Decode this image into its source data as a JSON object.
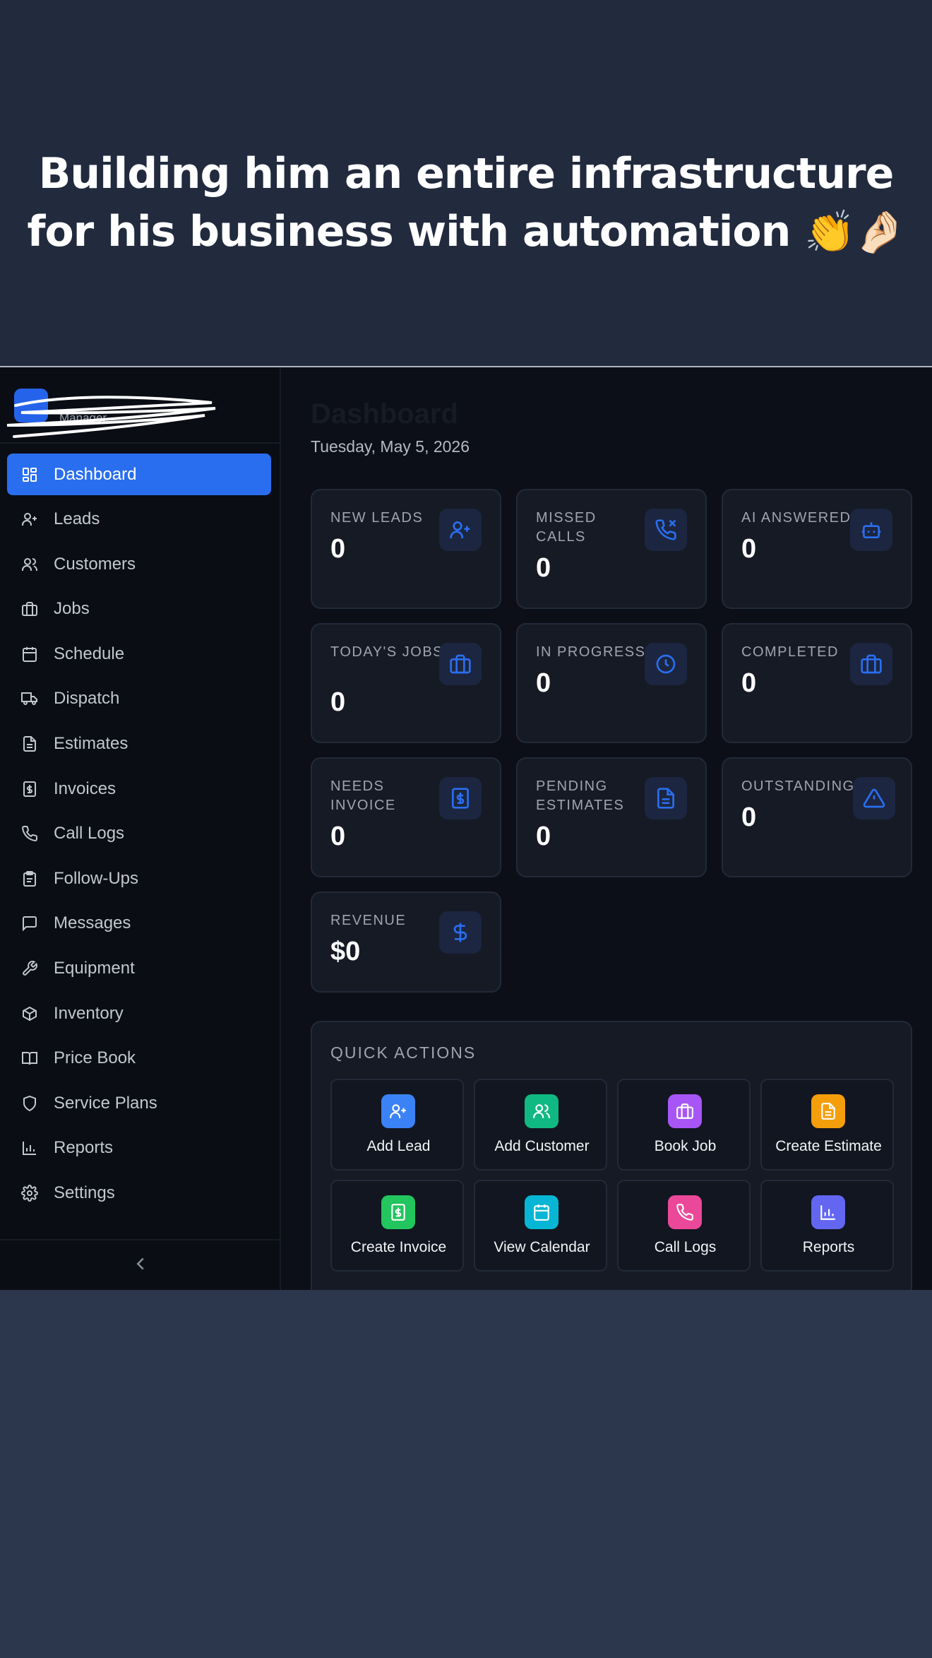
{
  "caption": {
    "text": "Building him an entire infrastructure for his business with automation",
    "emoji": "👏🤌🏻"
  },
  "colors": {
    "accent": "#2a6ef0",
    "app_background": "#0c0f17",
    "card_background": "#151a25",
    "caption_background": "#222a3e"
  },
  "brand": {
    "name": "",
    "subtitle": "Manager",
    "logo_icon": "logo-square"
  },
  "sidebar": {
    "items": [
      {
        "label": "Dashboard",
        "icon": "dashboard-icon",
        "active": true
      },
      {
        "label": "Leads",
        "icon": "user-plus-icon"
      },
      {
        "label": "Customers",
        "icon": "users-icon"
      },
      {
        "label": "Jobs",
        "icon": "briefcase-icon"
      },
      {
        "label": "Schedule",
        "icon": "calendar-icon"
      },
      {
        "label": "Dispatch",
        "icon": "truck-icon"
      },
      {
        "label": "Estimates",
        "icon": "document-icon"
      },
      {
        "label": "Invoices",
        "icon": "invoice-icon"
      },
      {
        "label": "Call Logs",
        "icon": "phone-icon"
      },
      {
        "label": "Follow-Ups",
        "icon": "clipboard-icon"
      },
      {
        "label": "Messages",
        "icon": "message-icon"
      },
      {
        "label": "Equipment",
        "icon": "wrench-icon"
      },
      {
        "label": "Inventory",
        "icon": "package-icon"
      },
      {
        "label": "Price Book",
        "icon": "book-icon"
      },
      {
        "label": "Service Plans",
        "icon": "shield-icon"
      },
      {
        "label": "Reports",
        "icon": "bar-chart-icon"
      },
      {
        "label": "Settings",
        "icon": "gear-icon"
      }
    ],
    "collapse_icon": "chevron-left-icon"
  },
  "header": {
    "title": "Dashboard",
    "date": "Tuesday, May 5, 2026"
  },
  "stats": [
    {
      "label": "NEW LEADS",
      "value": "0",
      "icon": "user-plus-icon"
    },
    {
      "label": "MISSED CALLS",
      "value": "0",
      "icon": "phone-missed-icon"
    },
    {
      "label": "AI ANSWERED",
      "value": "0",
      "icon": "bot-icon"
    },
    {
      "label": "TODAY'S JOBS",
      "value": "0",
      "icon": "briefcase-icon"
    },
    {
      "label": "IN PROGRESS",
      "value": "0",
      "icon": "clock-icon"
    },
    {
      "label": "COMPLETED",
      "value": "0",
      "icon": "briefcase-icon"
    },
    {
      "label": "NEEDS INVOICE",
      "value": "0",
      "icon": "invoice-icon"
    },
    {
      "label": "PENDING ESTIMATES",
      "value": "0",
      "icon": "document-icon"
    },
    {
      "label": "OUTSTANDING",
      "value": "0",
      "icon": "alert-triangle-icon"
    },
    {
      "label": "REVENUE",
      "value": "$0",
      "icon": "dollar-icon"
    }
  ],
  "quick_actions": {
    "title": "QUICK ACTIONS",
    "items": [
      {
        "label": "Add Lead",
        "icon": "user-plus-icon",
        "color": "#3b82f6"
      },
      {
        "label": "Add Customer",
        "icon": "users-icon",
        "color": "#10b981"
      },
      {
        "label": "Book Job",
        "icon": "briefcase-icon",
        "color": "#a855f7"
      },
      {
        "label": "Create Estimate",
        "icon": "document-icon",
        "color": "#f59e0b"
      },
      {
        "label": "Create Invoice",
        "icon": "invoice-icon",
        "color": "#22c55e"
      },
      {
        "label": "View Calendar",
        "icon": "calendar-icon",
        "color": "#06b6d4"
      },
      {
        "label": "Call Logs",
        "icon": "phone-icon",
        "color": "#ec4899"
      },
      {
        "label": "Reports",
        "icon": "bar-chart-icon",
        "color": "#6366f1"
      }
    ]
  }
}
